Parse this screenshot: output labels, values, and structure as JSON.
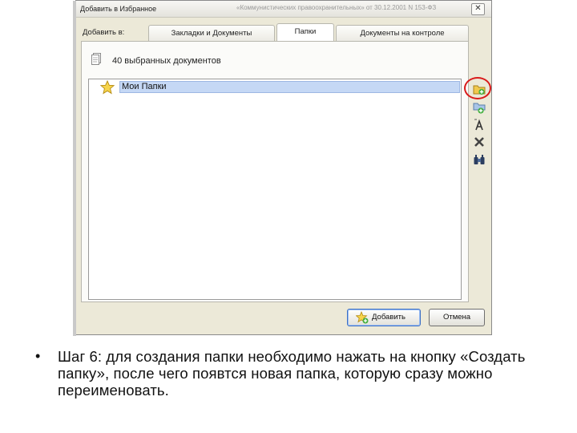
{
  "dialog": {
    "title": "Добавить в Избранное",
    "title_ghost": "«Коммунистических правоохранительных» от 30.12.2001 N 153-ФЗ",
    "close_glyph": "✕"
  },
  "tabs": {
    "label": "Добавить в:",
    "items": [
      {
        "label": "Закладки и Документы"
      },
      {
        "label": "Папки"
      },
      {
        "label": "Документы на контроле"
      }
    ]
  },
  "panel": {
    "doc_count": "40 выбранных документов"
  },
  "tree": {
    "items": [
      {
        "label": "Мои Папки",
        "icon": "star-icon"
      }
    ]
  },
  "toolbar_icons": [
    "create-folder-icon",
    "add-folder-icon",
    "rename-icon",
    "delete-icon",
    "find-icon"
  ],
  "buttons": {
    "add": "Добавить",
    "cancel": "Отмена"
  },
  "caption": {
    "bullet": "•",
    "text": "Шаг 6: для создания папки необходимо нажать на кнопку «Создать папку», после чего появтся новая папка, которую сразу можно переименовать."
  },
  "colors": {
    "dialog_bg": "#ece9d8",
    "selection": "#c5d8f5",
    "highlight_ring": "#d91a1a"
  }
}
